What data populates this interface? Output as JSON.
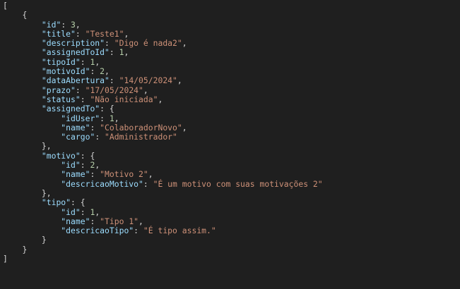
{
  "colors": {
    "background": "#1f1f1f",
    "key": "#9cdcfe",
    "string": "#ce9178",
    "number": "#b5cea8",
    "punctuation": "#d4d4d4"
  },
  "lines": [
    {
      "indent": 0,
      "tokens": [
        {
          "t": "p",
          "v": "["
        }
      ]
    },
    {
      "indent": 1,
      "tokens": [
        {
          "t": "p",
          "v": "{"
        }
      ]
    },
    {
      "indent": 2,
      "tokens": [
        {
          "t": "k",
          "v": "\"id\""
        },
        {
          "t": "p",
          "v": ": "
        },
        {
          "t": "n",
          "v": "3"
        },
        {
          "t": "p",
          "v": ","
        }
      ]
    },
    {
      "indent": 2,
      "tokens": [
        {
          "t": "k",
          "v": "\"title\""
        },
        {
          "t": "p",
          "v": ": "
        },
        {
          "t": "s",
          "v": "\"Teste1\""
        },
        {
          "t": "p",
          "v": ","
        }
      ]
    },
    {
      "indent": 2,
      "tokens": [
        {
          "t": "k",
          "v": "\"description\""
        },
        {
          "t": "p",
          "v": ": "
        },
        {
          "t": "s",
          "v": "\"Digo é nada2\""
        },
        {
          "t": "p",
          "v": ","
        }
      ]
    },
    {
      "indent": 2,
      "tokens": [
        {
          "t": "k",
          "v": "\"assignedToId\""
        },
        {
          "t": "p",
          "v": ": "
        },
        {
          "t": "n",
          "v": "1"
        },
        {
          "t": "p",
          "v": ","
        }
      ]
    },
    {
      "indent": 2,
      "tokens": [
        {
          "t": "k",
          "v": "\"tipoId\""
        },
        {
          "t": "p",
          "v": ": "
        },
        {
          "t": "n",
          "v": "1"
        },
        {
          "t": "p",
          "v": ","
        }
      ]
    },
    {
      "indent": 2,
      "tokens": [
        {
          "t": "k",
          "v": "\"motivoId\""
        },
        {
          "t": "p",
          "v": ": "
        },
        {
          "t": "n",
          "v": "2"
        },
        {
          "t": "p",
          "v": ","
        }
      ]
    },
    {
      "indent": 2,
      "tokens": [
        {
          "t": "k",
          "v": "\"dataAbertura\""
        },
        {
          "t": "p",
          "v": ": "
        },
        {
          "t": "s",
          "v": "\"14/05/2024\""
        },
        {
          "t": "p",
          "v": ","
        }
      ]
    },
    {
      "indent": 2,
      "tokens": [
        {
          "t": "k",
          "v": "\"prazo\""
        },
        {
          "t": "p",
          "v": ": "
        },
        {
          "t": "s",
          "v": "\"17/05/2024\""
        },
        {
          "t": "p",
          "v": ","
        }
      ]
    },
    {
      "indent": 2,
      "tokens": [
        {
          "t": "k",
          "v": "\"status\""
        },
        {
          "t": "p",
          "v": ": "
        },
        {
          "t": "s",
          "v": "\"Não iniciada\""
        },
        {
          "t": "p",
          "v": ","
        }
      ]
    },
    {
      "indent": 2,
      "tokens": [
        {
          "t": "k",
          "v": "\"assignedTo\""
        },
        {
          "t": "p",
          "v": ": {"
        }
      ]
    },
    {
      "indent": 3,
      "tokens": [
        {
          "t": "k",
          "v": "\"idUser\""
        },
        {
          "t": "p",
          "v": ": "
        },
        {
          "t": "n",
          "v": "1"
        },
        {
          "t": "p",
          "v": ","
        }
      ]
    },
    {
      "indent": 3,
      "tokens": [
        {
          "t": "k",
          "v": "\"name\""
        },
        {
          "t": "p",
          "v": ": "
        },
        {
          "t": "s",
          "v": "\"ColaboradorNovo\""
        },
        {
          "t": "p",
          "v": ","
        }
      ]
    },
    {
      "indent": 3,
      "tokens": [
        {
          "t": "k",
          "v": "\"cargo\""
        },
        {
          "t": "p",
          "v": ": "
        },
        {
          "t": "s",
          "v": "\"Administrador\""
        }
      ]
    },
    {
      "indent": 2,
      "tokens": [
        {
          "t": "p",
          "v": "},"
        }
      ]
    },
    {
      "indent": 2,
      "tokens": [
        {
          "t": "k",
          "v": "\"motivo\""
        },
        {
          "t": "p",
          "v": ": {"
        }
      ]
    },
    {
      "indent": 3,
      "tokens": [
        {
          "t": "k",
          "v": "\"id\""
        },
        {
          "t": "p",
          "v": ": "
        },
        {
          "t": "n",
          "v": "2"
        },
        {
          "t": "p",
          "v": ","
        }
      ]
    },
    {
      "indent": 3,
      "tokens": [
        {
          "t": "k",
          "v": "\"name\""
        },
        {
          "t": "p",
          "v": ": "
        },
        {
          "t": "s",
          "v": "\"Motivo 2\""
        },
        {
          "t": "p",
          "v": ","
        }
      ]
    },
    {
      "indent": 3,
      "tokens": [
        {
          "t": "k",
          "v": "\"descricaoMotivo\""
        },
        {
          "t": "p",
          "v": ": "
        },
        {
          "t": "s",
          "v": "\"É um motivo com suas motivações 2\""
        }
      ]
    },
    {
      "indent": 2,
      "tokens": [
        {
          "t": "p",
          "v": "},"
        }
      ]
    },
    {
      "indent": 2,
      "tokens": [
        {
          "t": "k",
          "v": "\"tipo\""
        },
        {
          "t": "p",
          "v": ": {"
        }
      ]
    },
    {
      "indent": 3,
      "tokens": [
        {
          "t": "k",
          "v": "\"id\""
        },
        {
          "t": "p",
          "v": ": "
        },
        {
          "t": "n",
          "v": "1"
        },
        {
          "t": "p",
          "v": ","
        }
      ]
    },
    {
      "indent": 3,
      "tokens": [
        {
          "t": "k",
          "v": "\"name\""
        },
        {
          "t": "p",
          "v": ": "
        },
        {
          "t": "s",
          "v": "\"Tipo 1\""
        },
        {
          "t": "p",
          "v": ","
        }
      ]
    },
    {
      "indent": 3,
      "tokens": [
        {
          "t": "k",
          "v": "\"descricaoTipo\""
        },
        {
          "t": "p",
          "v": ": "
        },
        {
          "t": "s",
          "v": "\"É tipo assim.\""
        }
      ]
    },
    {
      "indent": 2,
      "tokens": [
        {
          "t": "p",
          "v": "}"
        }
      ]
    },
    {
      "indent": 1,
      "tokens": [
        {
          "t": "p",
          "v": "}"
        }
      ]
    },
    {
      "indent": 0,
      "tokens": [
        {
          "t": "p",
          "v": "]"
        }
      ]
    }
  ]
}
